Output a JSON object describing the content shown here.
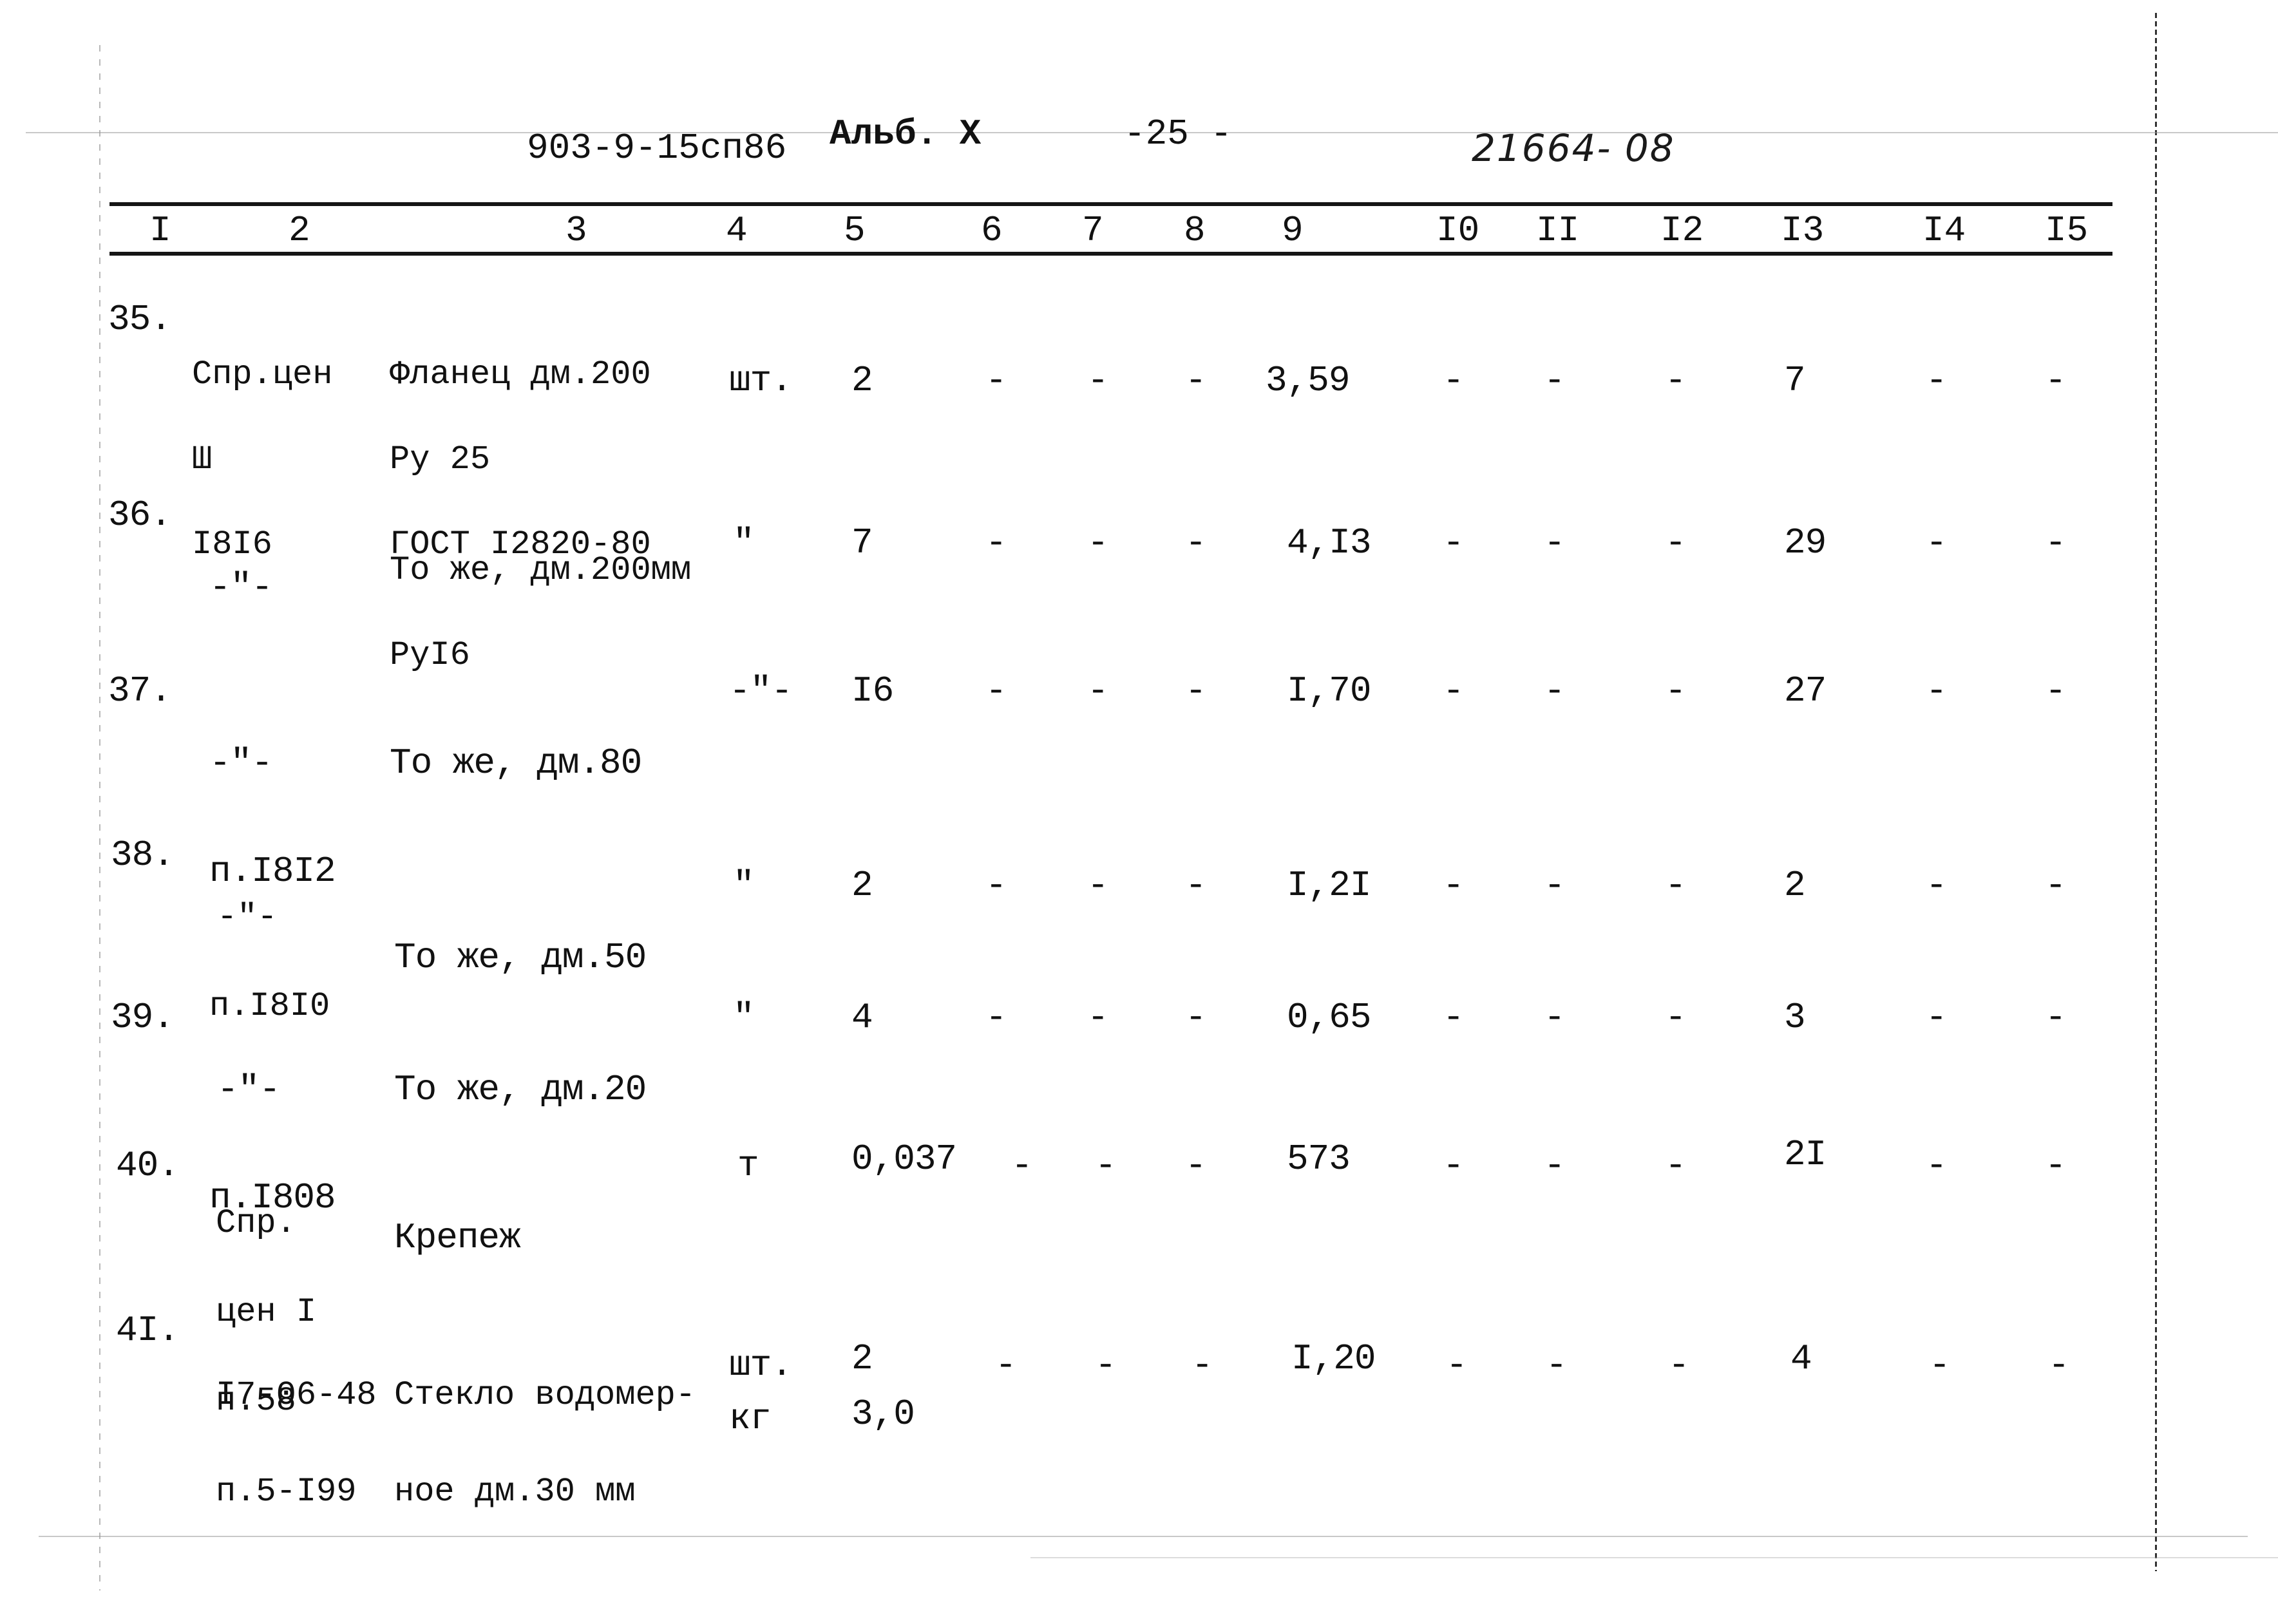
{
  "header": {
    "doc_code": "903-9-15сп86",
    "album": "Альб. X",
    "page": "-25 -",
    "inventory_number": "21664- 08"
  },
  "table": {
    "column_numbers": [
      "I",
      "2",
      "3",
      "4",
      "5",
      "6",
      "7",
      "8",
      "9",
      "I0",
      "II",
      "I2",
      "I3",
      "I4",
      "I5"
    ],
    "rows": [
      {
        "num": "35.",
        "ref": [
          "Спр.цен",
          "Ш",
          "I8I6"
        ],
        "name": [
          "Фланец дм.200",
          "Ру 25",
          "ГОСТ I2820-80"
        ],
        "unit": "шт.",
        "qty": "2",
        "c6": "-",
        "c7": "-",
        "c8": "-",
        "c9": "3,59",
        "c10": "-",
        "c11": "-",
        "c12": "-",
        "c13": "7",
        "c14": "-",
        "c15": "-"
      },
      {
        "num": "36.",
        "ref": [
          "-\"-"
        ],
        "name": [
          "То же, дм.200мм",
          "РуI6"
        ],
        "unit": "\"",
        "qty": "7",
        "c6": "-",
        "c7": "-",
        "c8": "-",
        "c9": "4,I3",
        "c10": "-",
        "c11": "-",
        "c12": "-",
        "c13": "29",
        "c14": "-",
        "c15": "-"
      },
      {
        "num": "37.",
        "ref": [
          "-\"-",
          "п.I8I2"
        ],
        "name": [
          "То же, дм.80"
        ],
        "unit": "-\"-",
        "qty": "I6",
        "c6": "-",
        "c7": "-",
        "c8": "-",
        "c9": "I,70",
        "c10": "-",
        "c11": "-",
        "c12": "-",
        "c13": "27",
        "c14": "-",
        "c15": "-"
      },
      {
        "num": "38.",
        "ref": [
          "-\"-",
          "п.I8I0"
        ],
        "name": [
          "То же, дм.50"
        ],
        "unit": "\"",
        "qty": "2",
        "c6": "-",
        "c7": "-",
        "c8": "-",
        "c9": "I,2I",
        "c10": "-",
        "c11": "-",
        "c12": "-",
        "c13": "2",
        "c14": "-",
        "c15": "-"
      },
      {
        "num": "39.",
        "ref": [
          "-\"-",
          "п.I808"
        ],
        "name": [
          "То же, дм.20"
        ],
        "unit": "\"",
        "qty": "4",
        "c6": "-",
        "c7": "-",
        "c8": "-",
        "c9": "0,65",
        "c10": "-",
        "c11": "-",
        "c12": "-",
        "c13": "3",
        "c14": "-",
        "c15": "-"
      },
      {
        "num": "40.",
        "ref": [
          "Спр.",
          "цен I",
          "п.58"
        ],
        "name": [
          "Крепеж"
        ],
        "unit": "т",
        "qty": "0,037",
        "c6": "-",
        "c7": "-",
        "c8": "-",
        "c9": "573",
        "c10": "-",
        "c11": "-",
        "c12": "-",
        "c13": "2I",
        "c14": "-",
        "c15": "-"
      },
      {
        "num": "4I.",
        "ref": [
          "I7-06-48",
          "п.5-I99"
        ],
        "name": [
          "Стекло водомер-",
          "ное дм.30 мм"
        ],
        "unit": "шт.",
        "qty": "2",
        "unit2": "кг",
        "qty2": "3,0",
        "c6": "-",
        "c7": "-",
        "c8": "-",
        "c9": "I,20",
        "c10": "-",
        "c11": "-",
        "c12": "-",
        "c13": "4",
        "c14": "-",
        "c15": "-"
      }
    ]
  }
}
